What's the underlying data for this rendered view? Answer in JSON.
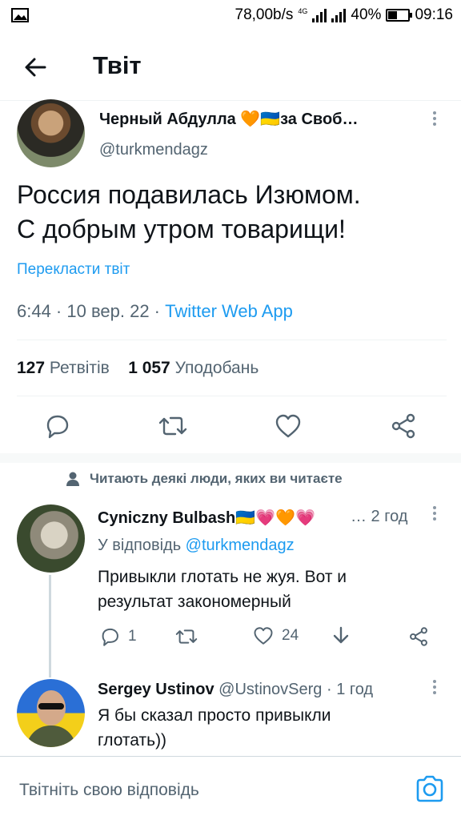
{
  "status_bar": {
    "speed": "78,00b/s",
    "network": "4G",
    "battery": "40%",
    "time": "09:16"
  },
  "header": {
    "title": "Твіт"
  },
  "tweet": {
    "name": "Черный Абдулла 🧡🇺🇦за Своб…",
    "handle": "@turkmendagz",
    "text_line1": "Россия подавилась Изюмом.",
    "text_line2": "С добрым утром товарищи!",
    "translate": "Перекласти твіт",
    "meta_time": "6:44 · 10 вер. 22 · ",
    "meta_app": "Twitter Web App",
    "retweets_count": "127",
    "retweets_label": "Ретвітів",
    "likes_count": "1 057",
    "likes_label": "Уподобань"
  },
  "followed_notice": "Читають деякі люди, яких ви читаєте",
  "replies": [
    {
      "name": "Cyniczny Bulbash🇺🇦💗🧡💗",
      "time": "… 2 год",
      "reply_prefix": "У відповідь ",
      "reply_handle": "@turkmendagz",
      "text_line1": "Привыкли глотать не жуя. Вот и",
      "text_line2": "результат закономерный",
      "replies": "1",
      "likes": "24"
    },
    {
      "name": "Sergey Ustinov",
      "handle": "@UstinovSerg",
      "time": "· 1 год",
      "text_line1": "Я бы сказал просто привыкли",
      "text_line2": "глотать))"
    }
  ],
  "composer": {
    "placeholder": "Твітніть свою відповідь"
  },
  "colors": {
    "accent": "#1d9bf0",
    "text": "#0f1419",
    "secondary": "#536471"
  }
}
